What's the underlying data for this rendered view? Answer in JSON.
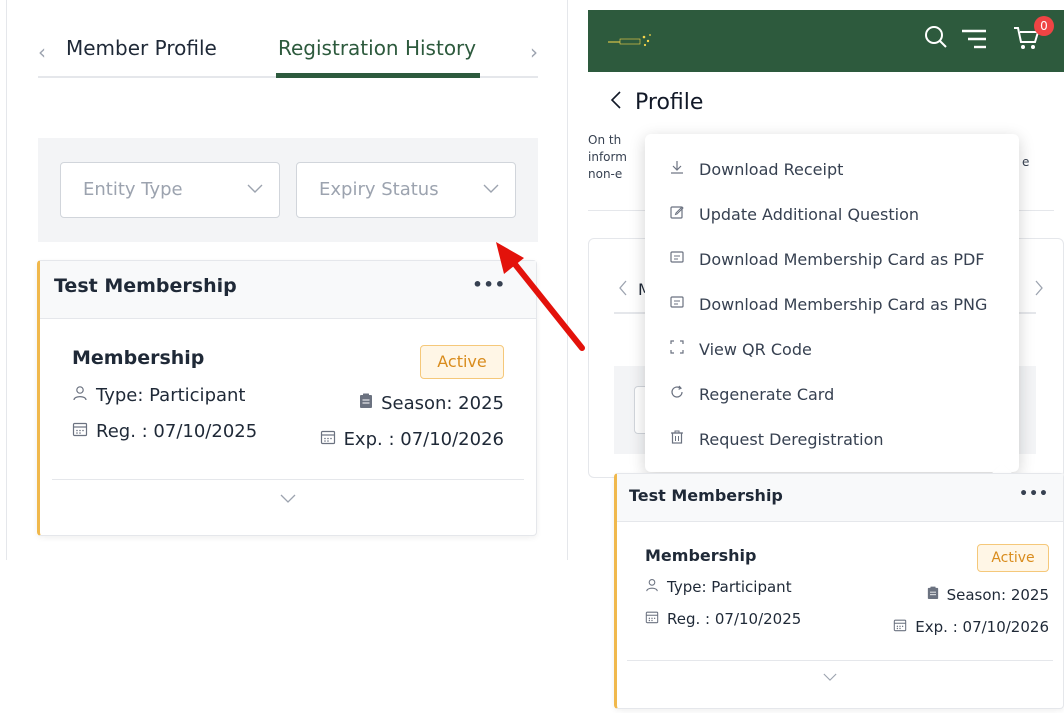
{
  "left": {
    "tabs": {
      "prev_icon": "‹",
      "profile_label": "Member Profile",
      "history_label": "Registration History",
      "next_icon": "›"
    },
    "filters": {
      "entity_type": "Entity Type",
      "expiry_status": "Expiry Status"
    },
    "card": {
      "title": "Test Membership",
      "more": "•••",
      "membership_type": "Membership",
      "status": "Active",
      "type": "Type: Participant",
      "reg": "Reg. : 07/10/2025",
      "season": "Season: 2025",
      "exp": "Exp. : 07/10/2026"
    }
  },
  "right": {
    "header": {
      "cart_count": "0"
    },
    "profile_title": "Profile",
    "description_fragments": [
      "On th",
      "inform",
      "non-e",
      "e"
    ],
    "under_tab_initial": "M",
    "dropdown": {
      "items": [
        {
          "icon": "download-icon",
          "label": "Download Receipt"
        },
        {
          "icon": "edit-icon",
          "label": "Update Additional Question"
        },
        {
          "icon": "card-icon",
          "label": "Download Membership Card as PDF"
        },
        {
          "icon": "card-icon",
          "label": "Download Membership Card as PNG"
        },
        {
          "icon": "qr-code-icon",
          "label": "View QR Code"
        },
        {
          "icon": "refresh-icon",
          "label": "Regenerate Card"
        },
        {
          "icon": "trash-icon",
          "label": "Request Deregistration"
        }
      ]
    },
    "card": {
      "title": "Test Membership",
      "more": "•••",
      "membership_type": "Membership",
      "status": "Active",
      "type": "Type: Participant",
      "reg": "Reg. : 07/10/2025",
      "season": "Season: 2025",
      "exp": "Exp. : 07/10/2026"
    }
  },
  "colors": {
    "brand_green": "#2d5a3d",
    "active_orange": "#d98c1d",
    "card_accent": "#f0b84c",
    "arrow_red": "#e3120b",
    "badge_red": "#ef4444"
  }
}
